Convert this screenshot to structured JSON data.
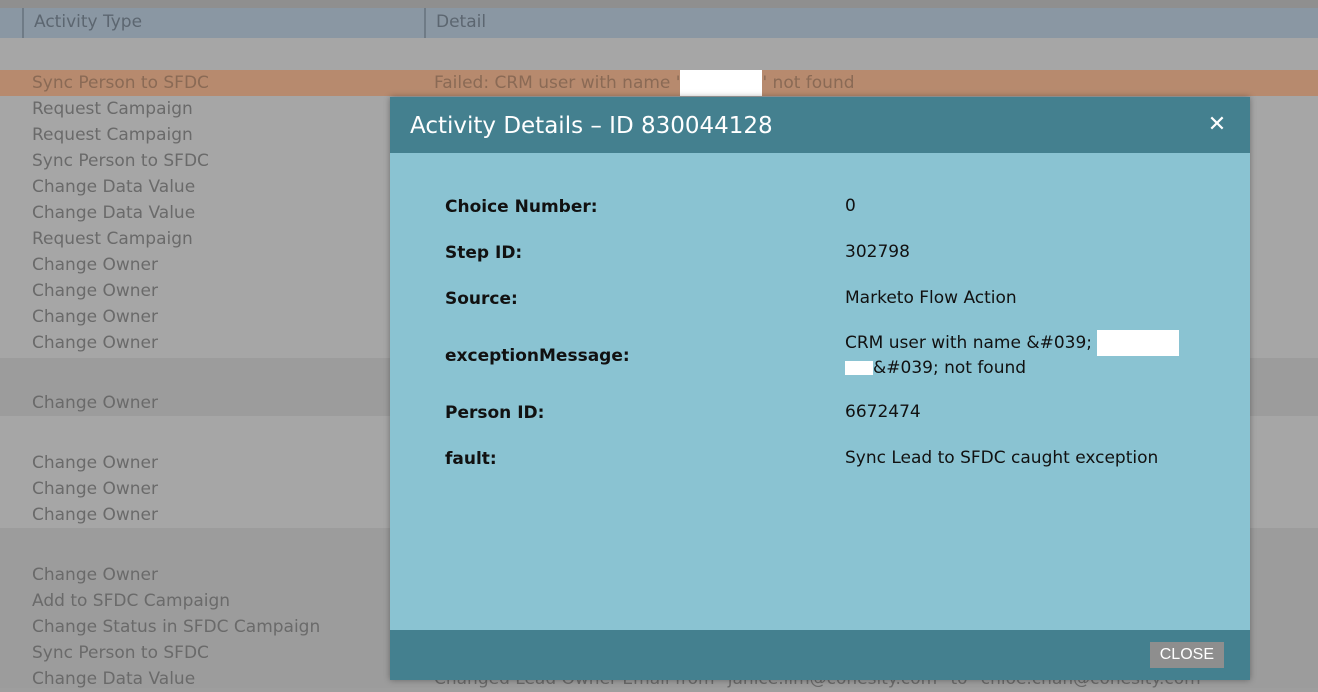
{
  "table": {
    "col_activity_type": "Activity Type",
    "col_detail": "Detail",
    "rows": [
      {
        "type": "Sync Person to SFDC",
        "detail": "Failed: CRM user with name '",
        "detail_tail": "' not found"
      },
      {
        "type": "Request Campaign",
        "detail": ""
      },
      {
        "type": "Request Campaign",
        "detail": ""
      },
      {
        "type": "Sync Person to SFDC",
        "detail": ""
      },
      {
        "type": "Change Data Value",
        "detail": ""
      },
      {
        "type": "Change Data Value",
        "detail": ""
      },
      {
        "type": "Request Campaign",
        "detail": ""
      },
      {
        "type": "Change Owner",
        "detail": ""
      },
      {
        "type": "Change Owner",
        "detail": ""
      },
      {
        "type": "Change Owner",
        "detail": ""
      },
      {
        "type": "Change Owner",
        "detail": ""
      },
      {
        "type": "Change Owner",
        "detail": ""
      },
      {
        "type": "Change Owner",
        "detail": ""
      },
      {
        "type": "Change Owner",
        "detail": ""
      },
      {
        "type": "Change Owner",
        "detail": ""
      },
      {
        "type": "Change Owner",
        "detail": ""
      },
      {
        "type": "Add to SFDC Campaign",
        "detail": ""
      },
      {
        "type": "Change Status in SFDC Campaign",
        "detail": ""
      },
      {
        "type": "Sync Person to SFDC",
        "detail": ""
      },
      {
        "type": "Change Data Value",
        "detail": "Changed Lead Owner Email from \"janice.lim@cohesity.com\" to \"chloe.chan@cohesity.com\""
      }
    ]
  },
  "modal": {
    "title": "Activity Details – ID 830044128",
    "close_x": "✕",
    "fields": [
      {
        "label": "Choice Number:",
        "value": "0"
      },
      {
        "label": "Step ID:",
        "value": "302798"
      },
      {
        "label": "Source:",
        "value": "Marketo Flow Action"
      },
      {
        "label": "exceptionMessage:",
        "value": "CRM user with name &#039;",
        "value_line2": "&#039; not found"
      },
      {
        "label": "Person ID:",
        "value": "6672474"
      },
      {
        "label": "fault:",
        "value": "Sync Lead to SFDC caught exception"
      }
    ],
    "close_button": "CLOSE"
  }
}
